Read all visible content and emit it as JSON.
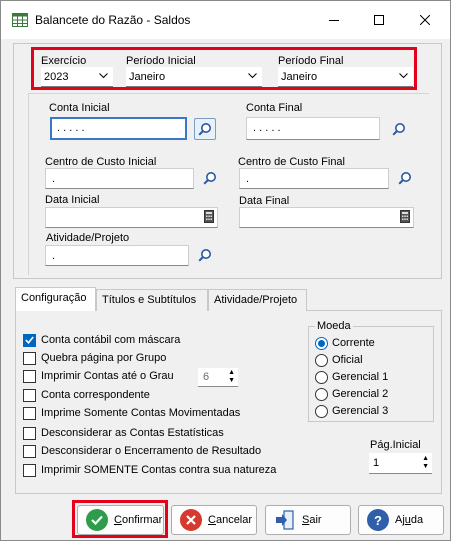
{
  "window": {
    "title": "Balancete do Razão - Saldos"
  },
  "period": {
    "exercicio_label": "Exercício",
    "exercicio_value": "2023",
    "periodo_inicial_label": "Período Inicial",
    "periodo_inicial_value": "Janeiro",
    "periodo_final_label": "Período Final",
    "periodo_final_value": "Janeiro"
  },
  "filters": {
    "conta_inicial_label": "Conta Inicial",
    "conta_inicial_value": ". . . . .",
    "conta_final_label": "Conta Final",
    "conta_final_value": ". . . . .",
    "cc_inicial_label": "Centro de Custo Inicial",
    "cc_inicial_value": ".",
    "cc_final_label": "Centro de Custo Final",
    "cc_final_value": ".",
    "data_inicial_label": "Data Inicial",
    "data_inicial_value": "",
    "data_final_label": "Data Final",
    "data_final_value": "",
    "atividade_label": "Atividade/Projeto",
    "atividade_value": "."
  },
  "tabs": [
    {
      "label": "Configuração",
      "active": true
    },
    {
      "label": "Títulos e Subtítulos",
      "active": false
    },
    {
      "label": "Atividade/Projeto",
      "active": false
    }
  ],
  "options": [
    {
      "label": "Conta contábil com máscara",
      "checked": true
    },
    {
      "label": "Quebra página por Grupo",
      "checked": false
    },
    {
      "label": "Imprimir Contas até o Grau",
      "checked": false
    },
    {
      "label": "Conta correspondente",
      "checked": false
    },
    {
      "label": "Imprime Somente Contas Movimentadas",
      "checked": false
    },
    {
      "label": "Desconsiderar as Contas Estatísticas",
      "checked": false
    },
    {
      "label": "Desconsiderar o Encerramento de Resultado",
      "checked": false
    },
    {
      "label": "Imprimir SOMENTE Contas contra sua natureza",
      "checked": false
    }
  ],
  "grau_value": "6",
  "moeda": {
    "title": "Moeda",
    "options": [
      {
        "label": "Corrente",
        "selected": true
      },
      {
        "label": "Oficial",
        "selected": false
      },
      {
        "label": "Gerencial 1",
        "selected": false
      },
      {
        "label": "Gerencial 2",
        "selected": false
      },
      {
        "label": "Gerencial 3",
        "selected": false
      }
    ]
  },
  "pagina": {
    "label": "Pág.Inicial",
    "value": "1"
  },
  "buttons": {
    "confirmar_first": "C",
    "confirmar_rest": "onfirmar",
    "cancelar_first": "C",
    "cancelar_rest": "ancelar",
    "sair_first": "S",
    "sair_rest": "air",
    "ajuda_first": "Aj",
    "ajuda_u": "u",
    "ajuda_rest": "da"
  },
  "colors": {
    "highlight_red": "#e5001c",
    "accent_blue": "#0067c0",
    "confirm_green": "#2e9c4a",
    "cancel_red": "#d63a2f",
    "help_blue": "#2f5fa8"
  }
}
